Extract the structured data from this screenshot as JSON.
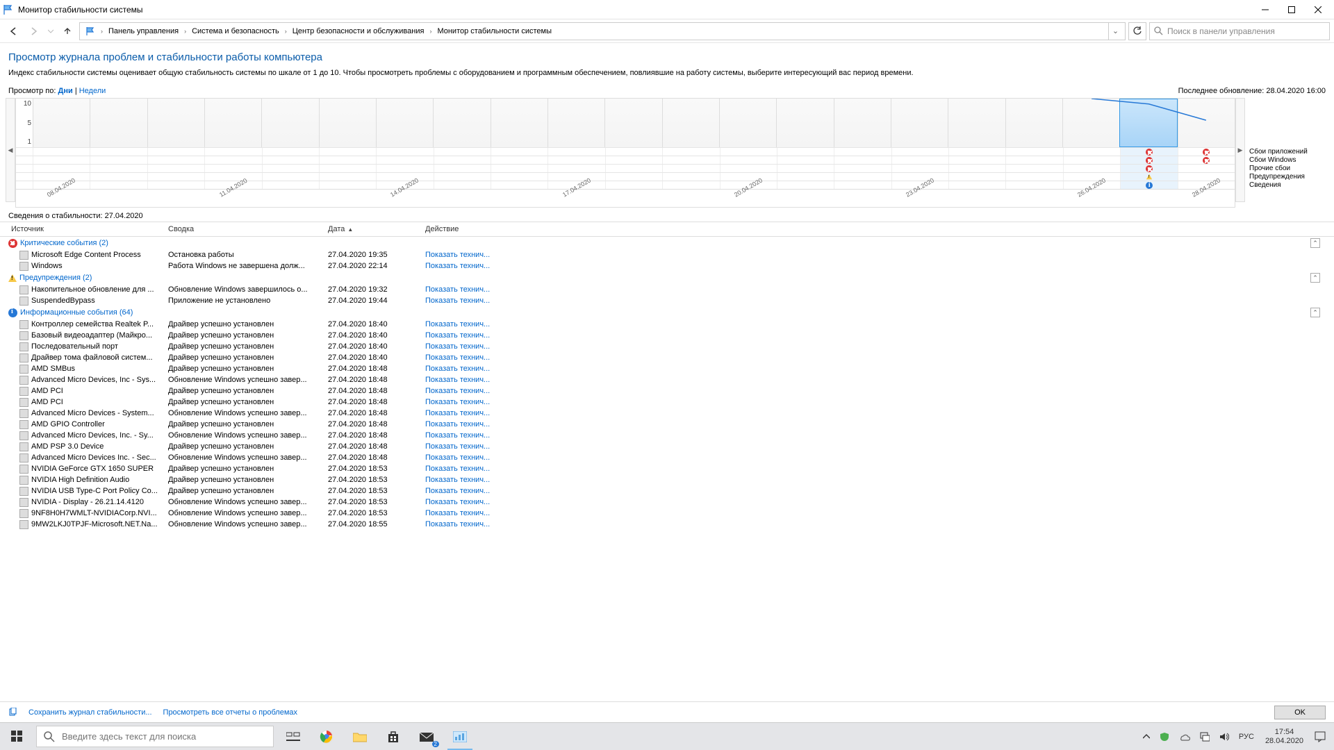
{
  "window": {
    "title": "Монитор стабильности системы"
  },
  "breadcrumb": {
    "items": [
      "Панель управления",
      "Система и безопасность",
      "Центр безопасности и обслуживания",
      "Монитор стабильности системы"
    ]
  },
  "search": {
    "placeholder": "Поиск в панели управления"
  },
  "page": {
    "heading": "Просмотр журнала проблем и стабильности работы компьютера",
    "desc": "Индекс стабильности системы оценивает общую стабильность системы по шкале от 1 до 10. Чтобы просмотреть проблемы с оборудованием и программным обеспечением, повлиявшие на работу системы, выберите интересующий вас период времени."
  },
  "view": {
    "label": "Просмотр по:",
    "days": "Дни",
    "weeks": "Недели",
    "last_update_label": "Последнее обновление:",
    "last_update": "28.04.2020 16:00"
  },
  "chart_data": {
    "type": "line",
    "title": "",
    "xlabel": "",
    "ylabel": "",
    "ylim": [
      1,
      10
    ],
    "y_ticks": [
      10,
      5,
      1
    ],
    "categories": [
      "08.04.2020",
      "09.04.2020",
      "10.04.2020",
      "11.04.2020",
      "12.04.2020",
      "13.04.2020",
      "14.04.2020",
      "15.04.2020",
      "16.04.2020",
      "17.04.2020",
      "18.04.2020",
      "19.04.2020",
      "20.04.2020",
      "21.04.2020",
      "22.04.2020",
      "23.04.2020",
      "24.04.2020",
      "25.04.2020",
      "26.04.2020",
      "27.04.2020",
      "28.04.2020"
    ],
    "x_tick_labels": [
      "08.04.2020",
      "",
      "",
      "11.04.2020",
      "",
      "",
      "14.04.2020",
      "",
      "",
      "17.04.2020",
      "",
      "",
      "20.04.2020",
      "",
      "",
      "23.04.2020",
      "",
      "",
      "26.04.2020",
      "",
      "28.04.2020"
    ],
    "values": [
      null,
      null,
      null,
      null,
      null,
      null,
      null,
      null,
      null,
      null,
      null,
      null,
      null,
      null,
      null,
      null,
      null,
      null,
      10,
      9,
      6
    ],
    "selected_index": 19,
    "event_rows": [
      {
        "label": "Сбои приложений",
        "markers": {
          "19": "error",
          "20": "error"
        }
      },
      {
        "label": "Сбои Windows",
        "markers": {
          "19": "error",
          "20": "error"
        }
      },
      {
        "label": "Прочие сбои",
        "markers": {
          "19": "error"
        }
      },
      {
        "label": "Предупреждения",
        "markers": {
          "19": "warn"
        }
      },
      {
        "label": "Сведения",
        "markers": {
          "19": "info"
        }
      }
    ]
  },
  "details": {
    "label_prefix": "Сведения о стабильности:",
    "date": "27.04.2020"
  },
  "table": {
    "headers": {
      "source": "Источник",
      "summary": "Сводка",
      "date": "Дата",
      "action": "Действие"
    },
    "action_link": "Показать технич...",
    "groups": [
      {
        "title": "Критические события (2)",
        "icon": "error",
        "rows": [
          {
            "src": "Microsoft Edge Content Process",
            "sum": "Остановка работы",
            "dt": "27.04.2020 19:35"
          },
          {
            "src": "Windows",
            "sum": "Работа Windows не завершена долж...",
            "dt": "27.04.2020 22:14"
          }
        ]
      },
      {
        "title": "Предупреждения (2)",
        "icon": "warn",
        "rows": [
          {
            "src": "Накопительное обновление для ...",
            "sum": "Обновление Windows завершилось о...",
            "dt": "27.04.2020 19:32"
          },
          {
            "src": "SuspendedBypass",
            "sum": "Приложение не установлено",
            "dt": "27.04.2020 19:44"
          }
        ]
      },
      {
        "title": "Информационные события (64)",
        "icon": "info",
        "rows": [
          {
            "src": "Контроллер семейства Realtek P...",
            "sum": "Драйвер успешно установлен",
            "dt": "27.04.2020 18:40"
          },
          {
            "src": "Базовый видеоадаптер (Майкро...",
            "sum": "Драйвер успешно установлен",
            "dt": "27.04.2020 18:40"
          },
          {
            "src": "Последовательный порт",
            "sum": "Драйвер успешно установлен",
            "dt": "27.04.2020 18:40"
          },
          {
            "src": "Драйвер тома файловой систем...",
            "sum": "Драйвер успешно установлен",
            "dt": "27.04.2020 18:40"
          },
          {
            "src": "AMD SMBus",
            "sum": "Драйвер успешно установлен",
            "dt": "27.04.2020 18:48"
          },
          {
            "src": "Advanced Micro Devices, Inc - Sys...",
            "sum": "Обновление Windows успешно завер...",
            "dt": "27.04.2020 18:48"
          },
          {
            "src": "AMD PCI",
            "sum": "Драйвер успешно установлен",
            "dt": "27.04.2020 18:48"
          },
          {
            "src": "AMD PCI",
            "sum": "Драйвер успешно установлен",
            "dt": "27.04.2020 18:48"
          },
          {
            "src": "Advanced Micro Devices - System...",
            "sum": "Обновление Windows успешно завер...",
            "dt": "27.04.2020 18:48"
          },
          {
            "src": "AMD GPIO Controller",
            "sum": "Драйвер успешно установлен",
            "dt": "27.04.2020 18:48"
          },
          {
            "src": "Advanced Micro Devices, Inc. - Sy...",
            "sum": "Обновление Windows успешно завер...",
            "dt": "27.04.2020 18:48"
          },
          {
            "src": "AMD PSP 3.0 Device",
            "sum": "Драйвер успешно установлен",
            "dt": "27.04.2020 18:48"
          },
          {
            "src": "Advanced Micro Devices Inc. - Sec...",
            "sum": "Обновление Windows успешно завер...",
            "dt": "27.04.2020 18:48"
          },
          {
            "src": "NVIDIA GeForce GTX 1650 SUPER",
            "sum": "Драйвер успешно установлен",
            "dt": "27.04.2020 18:53"
          },
          {
            "src": "NVIDIA High Definition Audio",
            "sum": "Драйвер успешно установлен",
            "dt": "27.04.2020 18:53"
          },
          {
            "src": "NVIDIA USB Type-C Port Policy Co...",
            "sum": "Драйвер успешно установлен",
            "dt": "27.04.2020 18:53"
          },
          {
            "src": "NVIDIA - Display - 26.21.14.4120",
            "sum": "Обновление Windows успешно завер...",
            "dt": "27.04.2020 18:53"
          },
          {
            "src": "9NF8H0H7WMLT-NVIDIACorp.NVI...",
            "sum": "Обновление Windows успешно завер...",
            "dt": "27.04.2020 18:53"
          },
          {
            "src": "9MW2LKJ0TPJF-Microsoft.NET.Na...",
            "sum": "Обновление Windows успешно завер...",
            "dt": "27.04.2020 18:55"
          }
        ]
      }
    ]
  },
  "bottom": {
    "save": "Сохранить журнал стабильности...",
    "view_reports": "Просмотреть все отчеты о проблемах",
    "ok": "OK"
  },
  "taskbar": {
    "search": "Введите здесь текст для поиска",
    "lang": "РУС",
    "time": "17:54",
    "date": "28.04.2020"
  }
}
